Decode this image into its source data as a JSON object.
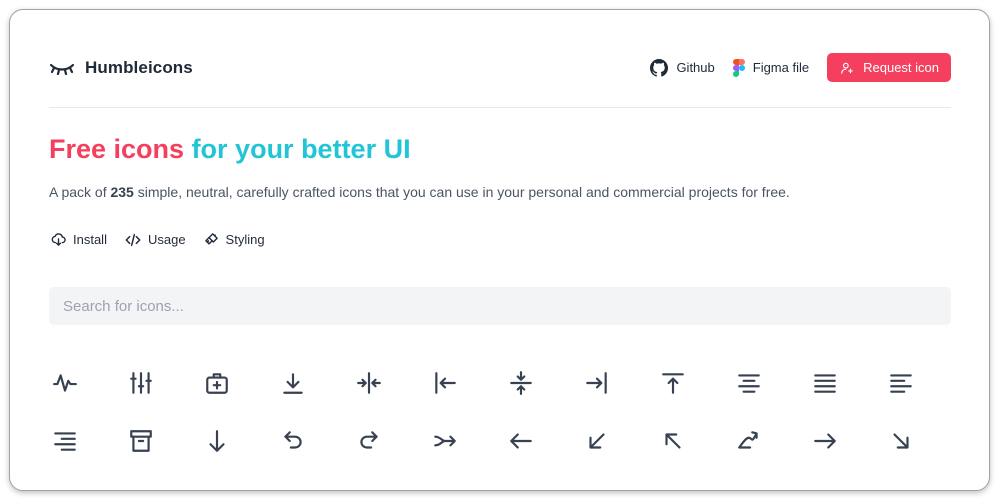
{
  "brand": {
    "name": "Humbleicons",
    "icon": "closed-eye-logo-icon"
  },
  "nav": {
    "github": {
      "label": "Github",
      "icon": "github-icon"
    },
    "figma": {
      "label": "Figma file",
      "icon": "figma-icon"
    },
    "request": {
      "label": "Request icon",
      "icon": "user-add-icon"
    }
  },
  "hero": {
    "title_part1": "Free icons",
    "title_part2": " for your better UI",
    "desc_prefix": "A pack of ",
    "count": "235",
    "desc_suffix": " simple, neutral, carefully crafted icons that you can use in your personal and commercial projects for free."
  },
  "links": [
    {
      "label": "Install",
      "icon": "cloud-download-icon"
    },
    {
      "label": "Usage",
      "icon": "code-icon"
    },
    {
      "label": "Styling",
      "icon": "brush-icon"
    }
  ],
  "search": {
    "placeholder": "Search for icons..."
  },
  "icons": [
    [
      "activity-icon",
      "adjustments-icon",
      "aid-icon",
      "download-icon",
      "align-objects-center-icon",
      "align-objects-left-icon",
      "align-objects-middle-icon",
      "align-objects-right-icon",
      "align-objects-top-icon",
      "align-text-center-icon",
      "align-text-justify-icon",
      "align-text-left-icon"
    ],
    [
      "align-text-right-icon",
      "archive-icon",
      "arrow-down-icon",
      "arrow-go-back-icon",
      "arrow-go-forward-icon",
      "arrow-join-icon",
      "arrow-left-icon",
      "arrow-left-down-icon",
      "arrow-left-up-icon",
      "arrow-loop-icon",
      "arrow-right-icon",
      "arrow-right-down-icon"
    ]
  ],
  "colors": {
    "accent": "#f43f5e",
    "accent_secondary": "#22c5d6",
    "search_bg": "#f3f4f6",
    "text": "#1f2937"
  }
}
